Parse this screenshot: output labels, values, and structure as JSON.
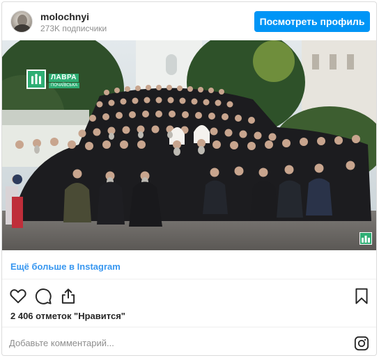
{
  "header": {
    "username": "molochnyi",
    "followers": "273K подписчики",
    "profile_button": "Посмотреть профиль"
  },
  "photo": {
    "watermark_title": "ЛАВРА",
    "watermark_subtitle": "ПОЧАЇВСЬКА"
  },
  "more_link": "Ещё больше в Instagram",
  "actions": {
    "like_icon": "heart-icon",
    "comment_icon": "comment-icon",
    "share_icon": "share-icon",
    "save_icon": "bookmark-icon"
  },
  "likes": "2 406 отметок \"Нравится\"",
  "comment": {
    "placeholder": "Добавьте комментарий..."
  },
  "colors": {
    "accent": "#0095f6",
    "link": "#3897f0",
    "watermark": "#2fae74"
  }
}
